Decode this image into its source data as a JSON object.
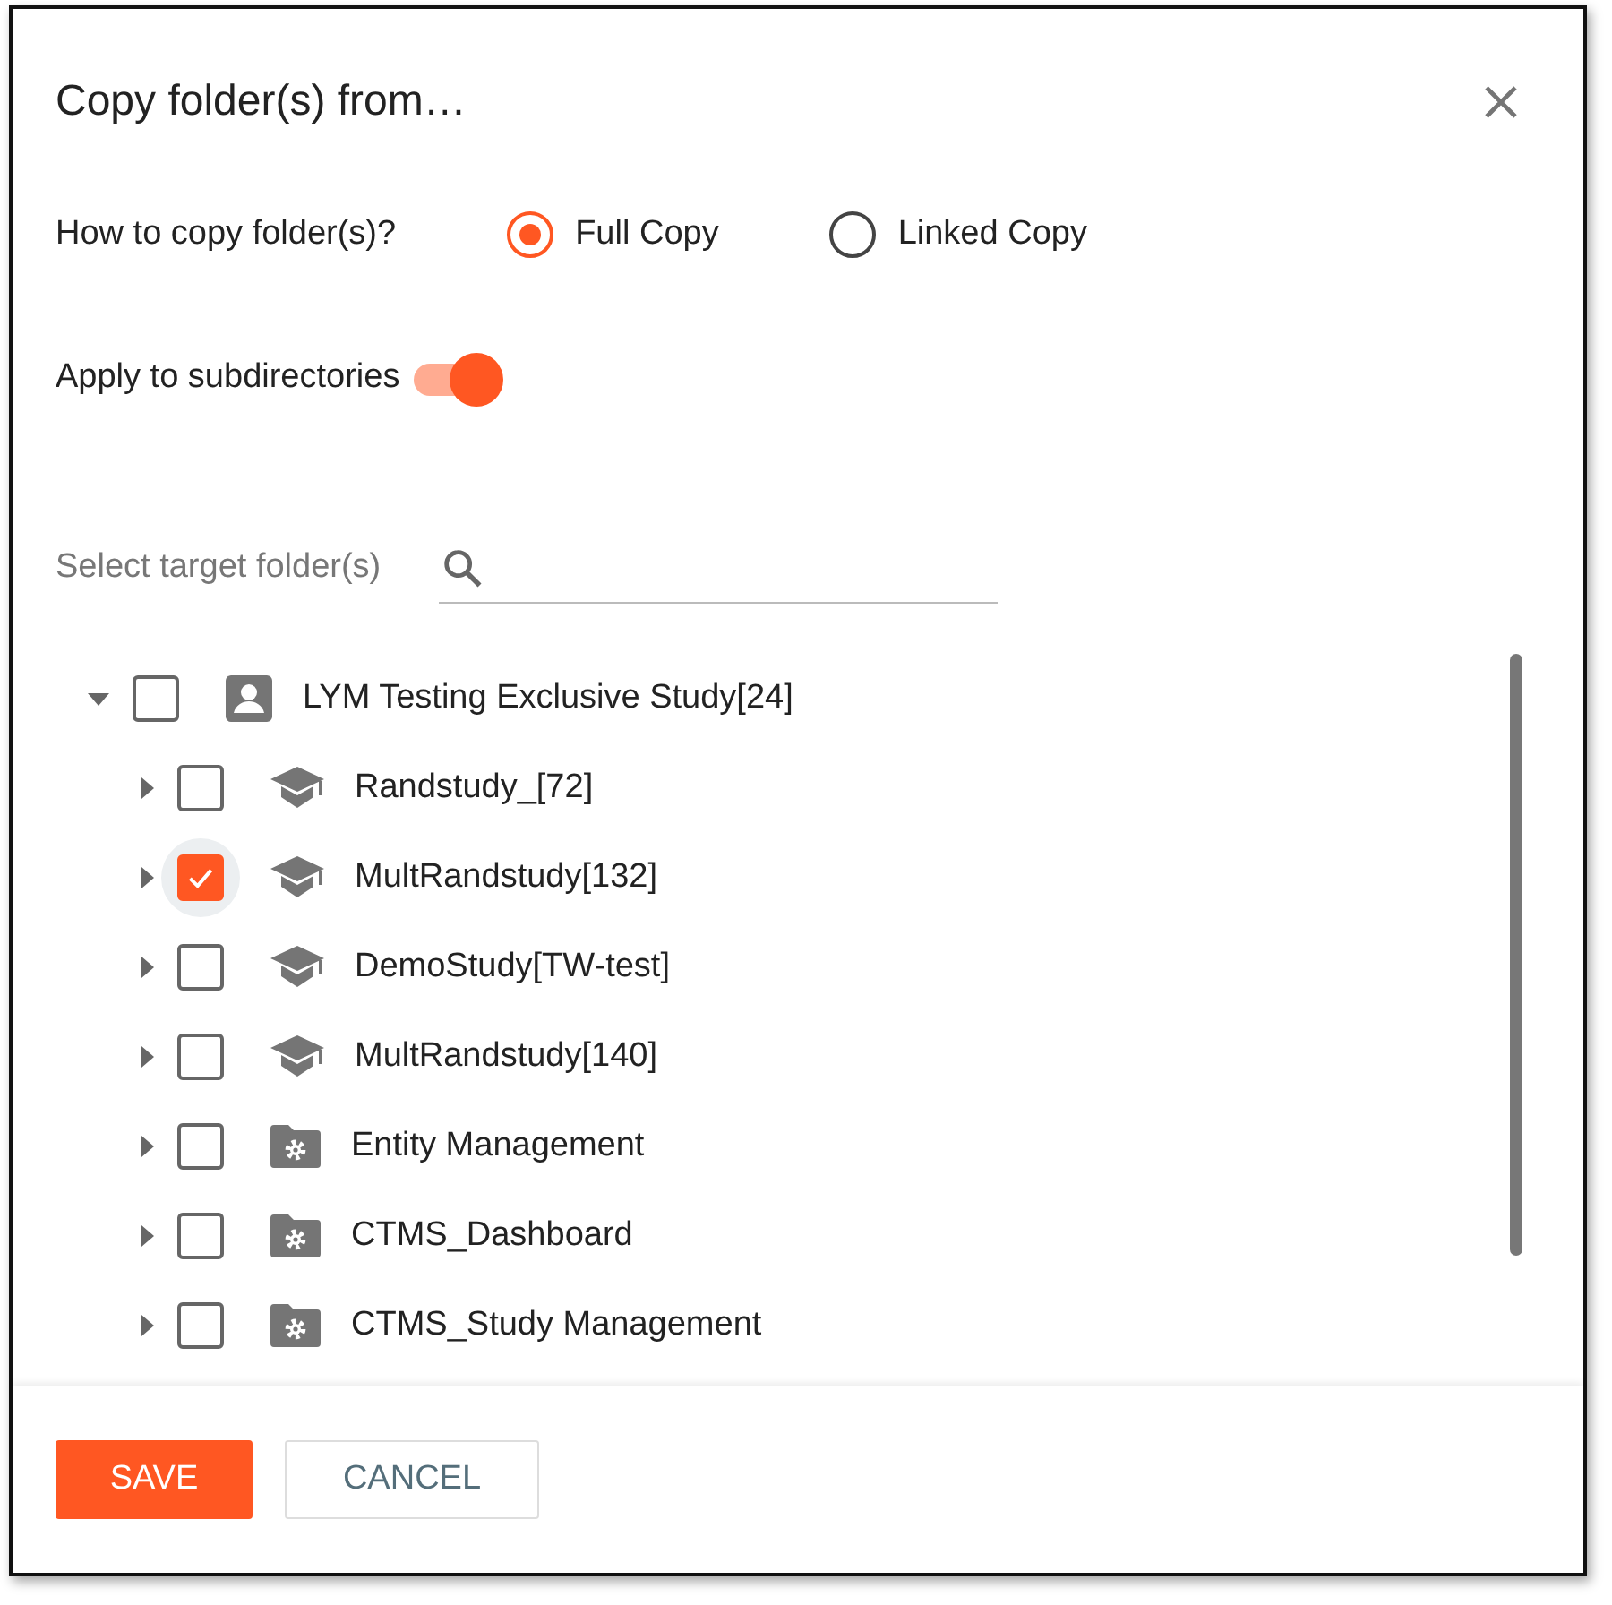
{
  "dialog": {
    "title": "Copy folder(s) from…"
  },
  "copy_mode": {
    "label": "How to copy folder(s)?",
    "options": [
      {
        "label": "Full Copy",
        "selected": true
      },
      {
        "label": "Linked Copy",
        "selected": false
      }
    ]
  },
  "apply_subdirectories": {
    "label": "Apply to subdirectories",
    "on": true
  },
  "search": {
    "label": "Select target folder(s)"
  },
  "tree": [
    {
      "label": "LYM Testing Exclusive Study[24]",
      "kind": "person",
      "checked": false,
      "expanded": true,
      "children": [
        {
          "label": "Randstudy_[72]",
          "kind": "study",
          "checked": false,
          "expanded": false
        },
        {
          "label": "MultRandstudy[132]",
          "kind": "study",
          "checked": true,
          "expanded": false
        },
        {
          "label": "DemoStudy[TW-test]",
          "kind": "study",
          "checked": false,
          "expanded": false
        },
        {
          "label": "MultRandstudy[140]",
          "kind": "study",
          "checked": false,
          "expanded": false
        },
        {
          "label": "Entity Management",
          "kind": "settings-folder",
          "checked": false,
          "expanded": false
        },
        {
          "label": "CTMS_Dashboard",
          "kind": "settings-folder",
          "checked": false,
          "expanded": false
        },
        {
          "label": "CTMS_Study Management",
          "kind": "settings-folder",
          "checked": false,
          "expanded": false
        }
      ]
    }
  ],
  "buttons": [
    {
      "label": "SAVE",
      "kind": "primary"
    },
    {
      "label": "CANCEL",
      "kind": "secondary"
    }
  ]
}
